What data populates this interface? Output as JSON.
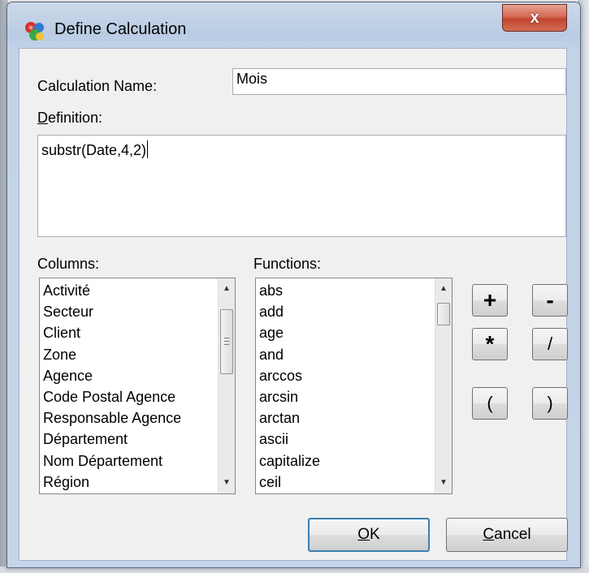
{
  "window": {
    "title": "Define Calculation",
    "close_label": "x"
  },
  "form": {
    "calc_name_label": "Calculation Name:",
    "calc_name_value": "Mois",
    "definition_label_accel": "D",
    "definition_label_rest": "efinition:",
    "definition_value": "substr(Date,4,2)",
    "columns_label": "Columns:",
    "functions_label": "Functions:"
  },
  "columns": [
    "Activité",
    "Secteur",
    "Client",
    "Zone",
    "Agence",
    "Code Postal Agence",
    "Responsable Agence",
    "Département",
    "Nom Département",
    "Région"
  ],
  "functions": [
    "abs",
    "add",
    "age",
    "and",
    "arccos",
    "arcsin",
    "arctan",
    "ascii",
    "capitalize",
    "ceil"
  ],
  "operators": {
    "plus": "+",
    "minus": "-",
    "multiply": "*",
    "divide": "/",
    "open_paren": "(",
    "close_paren": ")"
  },
  "buttons": {
    "ok_accel": "O",
    "ok_rest": "K",
    "cancel_accel": "C",
    "cancel_rest": "ancel"
  },
  "icons": {
    "app": "calculation-app-icon",
    "close": "close-icon",
    "scroll_up": "scroll-up-arrow-icon",
    "scroll_down": "scroll-down-arrow-icon"
  }
}
